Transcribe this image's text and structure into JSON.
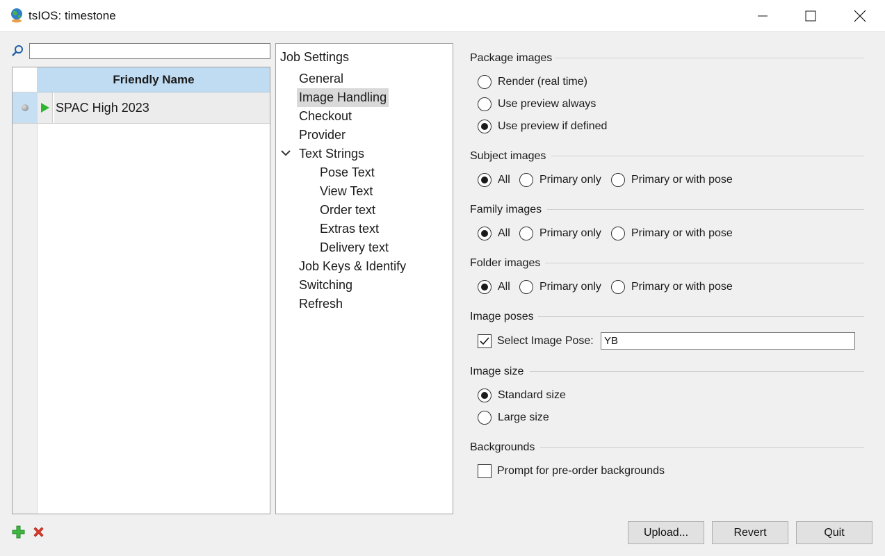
{
  "window": {
    "title": "tsIOS: timestone",
    "controls": [
      "minimize-icon",
      "maximize-icon",
      "close-icon"
    ]
  },
  "search": {
    "value": "",
    "placeholder": ""
  },
  "grid": {
    "column_header": "Friendly Name",
    "rows": [
      {
        "name": "SPAC High 2023",
        "status_icon": "play-icon"
      }
    ]
  },
  "tree": {
    "root": "Job Settings",
    "items": [
      {
        "label": "General"
      },
      {
        "label": "Image Handling",
        "selected": true
      },
      {
        "label": "Checkout"
      },
      {
        "label": "Provider"
      },
      {
        "label": "Text Strings",
        "expanded": true,
        "children": [
          "Pose Text",
          "View Text",
          "Order text",
          "Extras text",
          "Delivery text"
        ]
      },
      {
        "label": "Job Keys & Identify"
      },
      {
        "label": "Switching"
      },
      {
        "label": "Refresh"
      }
    ]
  },
  "settings": {
    "package_images": {
      "title": "Package images",
      "options": [
        "Render (real time)",
        "Use preview always",
        "Use preview if defined"
      ],
      "selected": "Use preview if defined"
    },
    "subject_images": {
      "title": "Subject images",
      "options": [
        "All",
        "Primary only",
        "Primary or with pose"
      ],
      "selected": "All"
    },
    "family_images": {
      "title": "Family images",
      "options": [
        "All",
        "Primary only",
        "Primary or with pose"
      ],
      "selected": "All"
    },
    "folder_images": {
      "title": "Folder images",
      "options": [
        "All",
        "Primary only",
        "Primary or with pose"
      ],
      "selected": "All"
    },
    "image_poses": {
      "title": "Image poses",
      "checkbox_label": "Select Image Pose:",
      "checked": true,
      "value": "YB"
    },
    "image_size": {
      "title": "Image size",
      "options": [
        "Standard size",
        "Large size"
      ],
      "selected": "Standard size"
    },
    "backgrounds": {
      "title": "Backgrounds",
      "checkbox_label": "Prompt for pre-order backgrounds",
      "checked": false
    }
  },
  "buttons": {
    "upload": "Upload...",
    "revert": "Revert",
    "quit": "Quit"
  },
  "icons": {
    "add": "add-icon",
    "delete": "delete-icon",
    "search": "search-icon"
  },
  "colors": {
    "header_bg": "#bfdcf2",
    "row_selector": "#c6dff3",
    "play_green": "#2fb52f",
    "delete_red": "#e03a2a",
    "add_green": "#3cb83c"
  }
}
